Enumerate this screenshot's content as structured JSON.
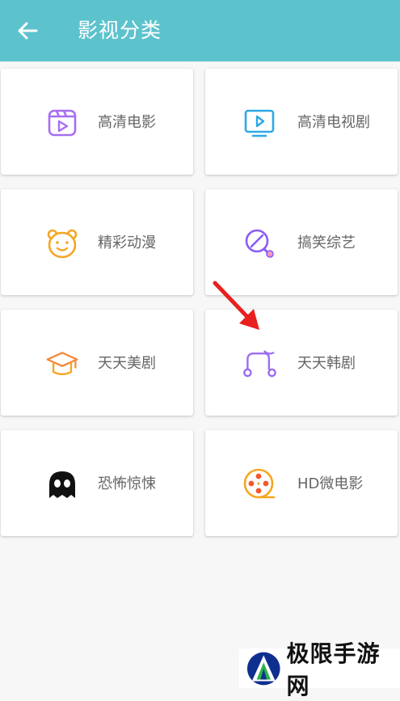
{
  "header": {
    "title": "影视分类",
    "back_icon": "arrow-left-icon",
    "background": "#5cc3cd"
  },
  "categories": [
    {
      "label": "高清电影",
      "icon": "film-clapper-icon",
      "color": "#a66ef5"
    },
    {
      "label": "高清电视剧",
      "icon": "tv-play-icon",
      "color": "#2ea8e6"
    },
    {
      "label": "精彩动漫",
      "icon": "bear-face-icon",
      "color": "#f5a623"
    },
    {
      "label": "搞笑综艺",
      "icon": "magnifier-lollipop-icon",
      "color": "#8a5cf6"
    },
    {
      "label": "天天美剧",
      "icon": "graduation-cap-icon",
      "color": "#f58a3d"
    },
    {
      "label": "天天韩剧",
      "icon": "music-note-icon",
      "color": "#9b6cf0"
    },
    {
      "label": "恐怖惊悚",
      "icon": "ghost-icon",
      "color": "#111111"
    },
    {
      "label": "HD微电影",
      "icon": "film-reel-icon",
      "color": "#f5a623"
    }
  ],
  "annotation": {
    "icon": "red-arrow-icon",
    "color": "#e8201f"
  },
  "watermark": {
    "text": "极限手游网",
    "icon": "jixian-logo-icon"
  }
}
